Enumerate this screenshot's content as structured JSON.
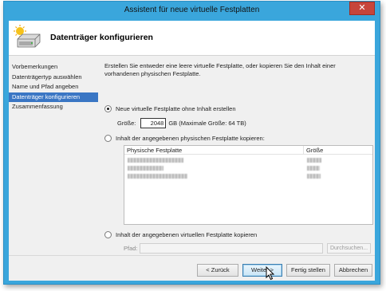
{
  "window": {
    "title": "Assistent für neue virtuelle Festplatten",
    "close_symbol": "✕"
  },
  "header": {
    "icon": "hard-disk-sun-icon",
    "title": "Datenträger konfigurieren"
  },
  "nav": {
    "items": [
      {
        "label": "Vorbemerkungen",
        "active": false
      },
      {
        "label": "Datenträgertyp auswählen",
        "active": false
      },
      {
        "label": "Name und Pfad angeben",
        "active": false
      },
      {
        "label": "Datenträger konfigurieren",
        "active": true
      },
      {
        "label": "Zusammenfassung",
        "active": false
      }
    ]
  },
  "content": {
    "intro": "Erstellen Sie entweder eine leere virtuelle Festplatte, oder kopieren Sie den Inhalt einer vorhandenen physischen Festplatte.",
    "option_new": {
      "label": "Neue virtuelle Festplatte ohne Inhalt erstellen",
      "checked": true
    },
    "size": {
      "label": "Größe:",
      "value": "2048",
      "unit_hint": "GB (Maximale Größe: 64 TB)"
    },
    "option_physical": {
      "label": "Inhalt der angegebenen physischen Festplatte kopieren:",
      "checked": false
    },
    "table": {
      "columns": [
        "Physische Festplatte",
        "Größe"
      ]
    },
    "option_virtual": {
      "label": "Inhalt der angegebenen virtuellen Festplatte kopieren",
      "checked": false
    },
    "path": {
      "label": "Pfad:",
      "value": ""
    },
    "browse_label": "Durchsuchen..."
  },
  "buttons": {
    "back": "< Zurück",
    "next": "Weiter >",
    "finish": "Fertig stellen",
    "cancel": "Abbrechen"
  },
  "colors": {
    "accent_border": "#3aa6dc",
    "nav_selected": "#3a76c4",
    "close_button": "#c7453b"
  }
}
